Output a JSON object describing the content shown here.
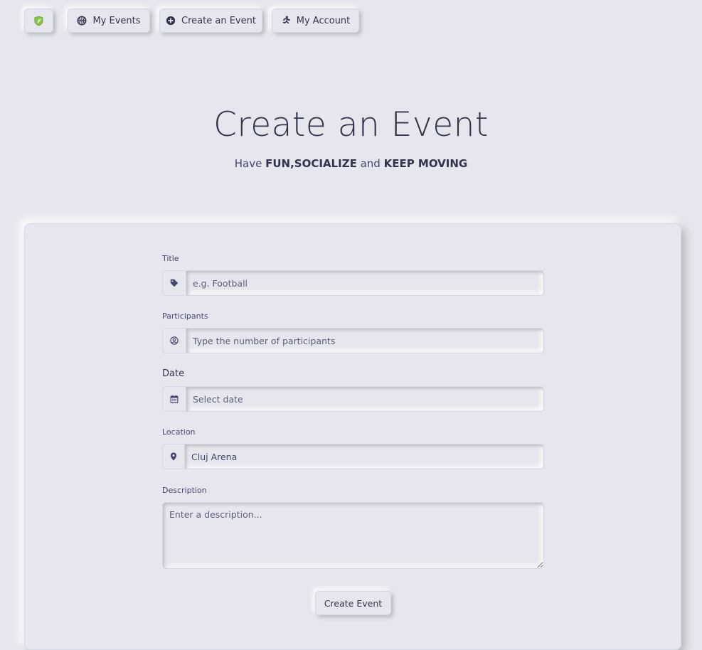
{
  "nav": {
    "logo_icon": "leaf-shield-icon",
    "items": [
      {
        "label": "My Events",
        "icon": "basketball-icon"
      },
      {
        "label": "Create an Event",
        "icon": "plus-circle-icon"
      },
      {
        "label": "My Account",
        "icon": "running-icon"
      }
    ]
  },
  "header": {
    "title": "Create an Event",
    "subtitle": {
      "pre": "Have ",
      "fun": "FUN",
      "comma": ",",
      "social": "SOCIALIZE",
      "and": " and ",
      "keep": "KEEP MOVING"
    }
  },
  "form": {
    "title": {
      "label": "Title",
      "placeholder": "e.g. Football",
      "icon": "tag-icon"
    },
    "participants": {
      "label": "Participants",
      "placeholder": "Type the number of participants",
      "icon": "user-circle-icon"
    },
    "date": {
      "label": "Date",
      "placeholder": "Select date",
      "icon": "calendar-icon"
    },
    "location": {
      "label": "Location",
      "value": "Cluj Arena",
      "icon": "map-pin-icon"
    },
    "description": {
      "label": "Description",
      "placeholder": "Enter a description..."
    },
    "submit_label": "Create Event"
  },
  "colors": {
    "background": "#e6e7ee",
    "text": "#44476a",
    "accent_logo": "#8bc34a"
  }
}
